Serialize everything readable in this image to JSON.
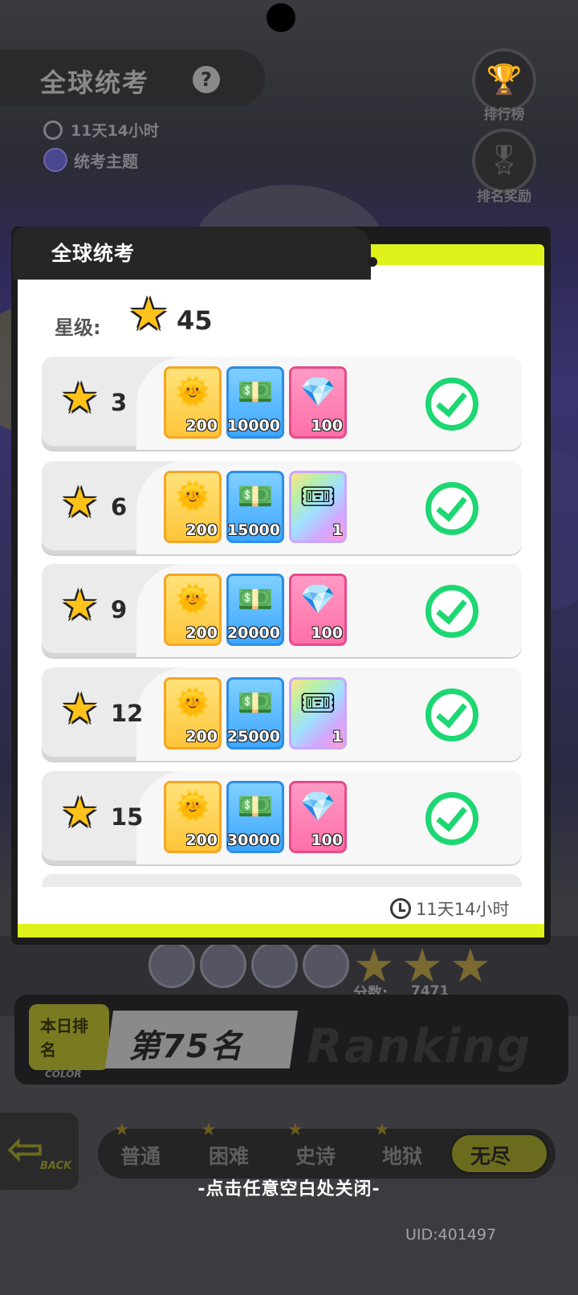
{
  "background": {
    "event_title": "全球统考",
    "help_icon": "?",
    "timer": "11天14小时",
    "theme_label": "统考主题",
    "side_buttons": [
      {
        "label": "排行榜",
        "icon": "trophy-icon"
      },
      {
        "label": "排名奖励",
        "icon": "medal-icon"
      }
    ],
    "score_label": "分数:",
    "score_value": "7471",
    "rank_tag": "本日排名",
    "rank_tag_sub": "COLOR",
    "rank_text": "第75名",
    "rank_watermark": "Ranking",
    "back_label": "BACK",
    "modes": [
      "普通",
      "困难",
      "史诗",
      "地狱",
      "无尽"
    ],
    "active_mode": "无尽",
    "close_hint": "-点击任意空白处关闭-",
    "uid": "UID:401497"
  },
  "modal": {
    "title": "全球统考",
    "stars_label": "星级:",
    "stars_value": "45",
    "footer_timer": "11天14小时",
    "rows": [
      {
        "stars": "3",
        "rewards": [
          {
            "type": "badge",
            "qty": "200"
          },
          {
            "type": "cash",
            "qty": "10000"
          },
          {
            "type": "diamond",
            "qty": "100"
          }
        ],
        "claimed": true
      },
      {
        "stars": "6",
        "rewards": [
          {
            "type": "badge",
            "qty": "200"
          },
          {
            "type": "cash",
            "qty": "15000"
          },
          {
            "type": "ticket",
            "qty": "1"
          }
        ],
        "claimed": true
      },
      {
        "stars": "9",
        "rewards": [
          {
            "type": "badge",
            "qty": "200"
          },
          {
            "type": "cash",
            "qty": "20000"
          },
          {
            "type": "diamond",
            "qty": "100"
          }
        ],
        "claimed": true
      },
      {
        "stars": "12",
        "rewards": [
          {
            "type": "badge",
            "qty": "200"
          },
          {
            "type": "cash",
            "qty": "25000"
          },
          {
            "type": "ticket",
            "qty": "1"
          }
        ],
        "claimed": true
      },
      {
        "stars": "15",
        "rewards": [
          {
            "type": "badge",
            "qty": "200"
          },
          {
            "type": "cash",
            "qty": "30000"
          },
          {
            "type": "diamond",
            "qty": "100"
          }
        ],
        "claimed": true
      }
    ]
  },
  "colors": {
    "accent_yellow": "#dff21a",
    "check_green": "#1dd872",
    "star_gold": "#ffc21a"
  }
}
